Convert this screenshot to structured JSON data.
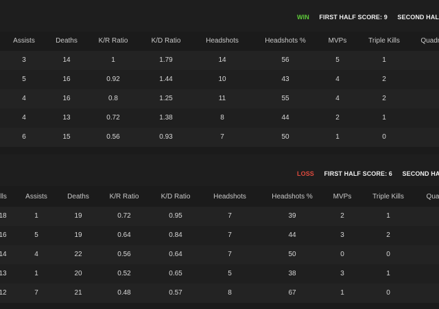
{
  "teams": [
    {
      "result": "WIN",
      "first_half_score": "FIRST HALF SCORE: 9",
      "second_half_label": "SECOND HALF",
      "columns": [
        "Assists",
        "Deaths",
        "K/R Ratio",
        "K/D Ratio",
        "Headshots",
        "Headshots %",
        "MVPs",
        "Triple Kills",
        "Quadro"
      ],
      "rows": [
        [
          "3",
          "14",
          "1",
          "1.79",
          "14",
          "56",
          "5",
          "1"
        ],
        [
          "5",
          "16",
          "0.92",
          "1.44",
          "10",
          "43",
          "4",
          "2"
        ],
        [
          "4",
          "16",
          "0.8",
          "1.25",
          "11",
          "55",
          "4",
          "2"
        ],
        [
          "4",
          "13",
          "0.72",
          "1.38",
          "8",
          "44",
          "2",
          "1"
        ],
        [
          "6",
          "15",
          "0.56",
          "0.93",
          "7",
          "50",
          "1",
          "0"
        ]
      ]
    },
    {
      "result": "LOSS",
      "first_half_score": "FIRST HALF SCORE: 6",
      "second_half_label": "SECOND HALF",
      "columns": [
        "ills",
        "Assists",
        "Deaths",
        "K/R Ratio",
        "K/D Ratio",
        "Headshots",
        "Headshots %",
        "MVPs",
        "Triple Kills",
        "Qua"
      ],
      "rows": [
        [
          "18",
          "1",
          "19",
          "0.72",
          "0.95",
          "7",
          "39",
          "2",
          "1"
        ],
        [
          "16",
          "5",
          "19",
          "0.64",
          "0.84",
          "7",
          "44",
          "3",
          "2"
        ],
        [
          "14",
          "4",
          "22",
          "0.56",
          "0.64",
          "7",
          "50",
          "0",
          "0"
        ],
        [
          "13",
          "1",
          "20",
          "0.52",
          "0.65",
          "5",
          "38",
          "3",
          "1"
        ],
        [
          "12",
          "7",
          "21",
          "0.48",
          "0.57",
          "8",
          "67",
          "1",
          "0"
        ]
      ]
    }
  ],
  "colors": {
    "win": "#5fce3a",
    "loss": "#e04a3e",
    "background": "#1b1b1b"
  }
}
